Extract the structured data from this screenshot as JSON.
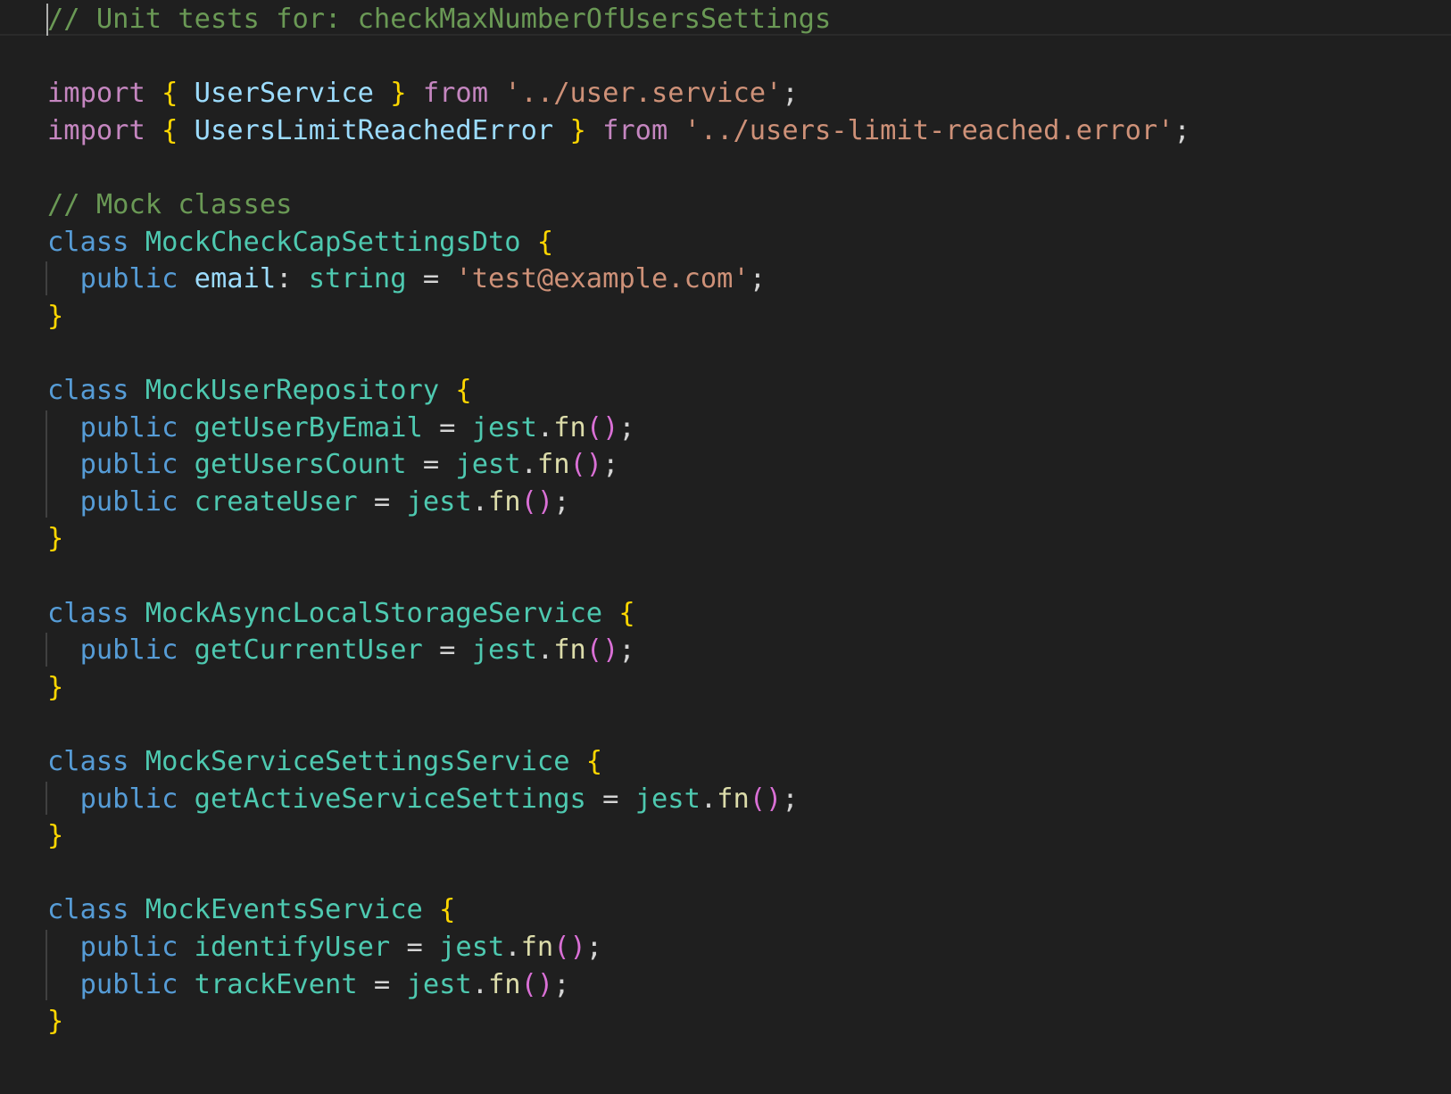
{
  "editor": {
    "language": "typescript",
    "theme_colors": {
      "background": "#1f1f1f",
      "comment": "#6a9955",
      "keyword": "#c586c0",
      "storage": "#569cd6",
      "brace": "#ffd700",
      "paren": "#da70d6",
      "variable": "#9cdcfe",
      "type": "#4ec9b0",
      "function": "#dcdcaa",
      "string": "#ce9178",
      "punctuation": "#d4d4d4"
    },
    "lines": [
      {
        "tokens": [
          {
            "text": "// Unit tests for: checkMaxNumberOfUsersSettings",
            "type": "comment"
          }
        ]
      },
      {
        "tokens": []
      },
      {
        "tokens": [
          {
            "text": "import",
            "type": "keyword"
          },
          {
            "text": " ",
            "type": "punct"
          },
          {
            "text": "{",
            "type": "brace"
          },
          {
            "text": " ",
            "type": "punct"
          },
          {
            "text": "UserService",
            "type": "var"
          },
          {
            "text": " ",
            "type": "punct"
          },
          {
            "text": "}",
            "type": "brace"
          },
          {
            "text": " ",
            "type": "punct"
          },
          {
            "text": "from",
            "type": "keyword"
          },
          {
            "text": " ",
            "type": "punct"
          },
          {
            "text": "'../user.service'",
            "type": "string"
          },
          {
            "text": ";",
            "type": "punct"
          }
        ]
      },
      {
        "tokens": [
          {
            "text": "import",
            "type": "keyword"
          },
          {
            "text": " ",
            "type": "punct"
          },
          {
            "text": "{",
            "type": "brace"
          },
          {
            "text": " ",
            "type": "punct"
          },
          {
            "text": "UsersLimitReachedError",
            "type": "var"
          },
          {
            "text": " ",
            "type": "punct"
          },
          {
            "text": "}",
            "type": "brace"
          },
          {
            "text": " ",
            "type": "punct"
          },
          {
            "text": "from",
            "type": "keyword"
          },
          {
            "text": " ",
            "type": "punct"
          },
          {
            "text": "'../users-limit-reached.error'",
            "type": "string"
          },
          {
            "text": ";",
            "type": "punct"
          }
        ]
      },
      {
        "tokens": []
      },
      {
        "tokens": [
          {
            "text": "// Mock classes",
            "type": "comment"
          }
        ]
      },
      {
        "tokens": [
          {
            "text": "class",
            "type": "storage"
          },
          {
            "text": " ",
            "type": "punct"
          },
          {
            "text": "MockCheckCapSettingsDto",
            "type": "type"
          },
          {
            "text": " ",
            "type": "punct"
          },
          {
            "text": "{",
            "type": "brace"
          }
        ]
      },
      {
        "tokens": [
          {
            "text": "  ",
            "type": "punct"
          },
          {
            "text": "public",
            "type": "storage"
          },
          {
            "text": " ",
            "type": "punct"
          },
          {
            "text": "email",
            "type": "var"
          },
          {
            "text": ": ",
            "type": "punct"
          },
          {
            "text": "string",
            "type": "type"
          },
          {
            "text": " = ",
            "type": "punct"
          },
          {
            "text": "'test@example.com'",
            "type": "string"
          },
          {
            "text": ";",
            "type": "punct"
          }
        ]
      },
      {
        "tokens": [
          {
            "text": "}",
            "type": "brace"
          }
        ]
      },
      {
        "tokens": []
      },
      {
        "tokens": [
          {
            "text": "class",
            "type": "storage"
          },
          {
            "text": " ",
            "type": "punct"
          },
          {
            "text": "MockUserRepository",
            "type": "type"
          },
          {
            "text": " ",
            "type": "punct"
          },
          {
            "text": "{",
            "type": "brace"
          }
        ]
      },
      {
        "tokens": [
          {
            "text": "  ",
            "type": "punct"
          },
          {
            "text": "public",
            "type": "storage"
          },
          {
            "text": " ",
            "type": "punct"
          },
          {
            "text": "getUserByEmail",
            "type": "type"
          },
          {
            "text": " = ",
            "type": "punct"
          },
          {
            "text": "jest",
            "type": "type"
          },
          {
            "text": ".",
            "type": "punct"
          },
          {
            "text": "fn",
            "type": "func"
          },
          {
            "text": "()",
            "type": "paren"
          },
          {
            "text": ";",
            "type": "punct"
          }
        ]
      },
      {
        "tokens": [
          {
            "text": "  ",
            "type": "punct"
          },
          {
            "text": "public",
            "type": "storage"
          },
          {
            "text": " ",
            "type": "punct"
          },
          {
            "text": "getUsersCount",
            "type": "type"
          },
          {
            "text": " = ",
            "type": "punct"
          },
          {
            "text": "jest",
            "type": "type"
          },
          {
            "text": ".",
            "type": "punct"
          },
          {
            "text": "fn",
            "type": "func"
          },
          {
            "text": "()",
            "type": "paren"
          },
          {
            "text": ";",
            "type": "punct"
          }
        ]
      },
      {
        "tokens": [
          {
            "text": "  ",
            "type": "punct"
          },
          {
            "text": "public",
            "type": "storage"
          },
          {
            "text": " ",
            "type": "punct"
          },
          {
            "text": "createUser",
            "type": "type"
          },
          {
            "text": " = ",
            "type": "punct"
          },
          {
            "text": "jest",
            "type": "type"
          },
          {
            "text": ".",
            "type": "punct"
          },
          {
            "text": "fn",
            "type": "func"
          },
          {
            "text": "()",
            "type": "paren"
          },
          {
            "text": ";",
            "type": "punct"
          }
        ]
      },
      {
        "tokens": [
          {
            "text": "}",
            "type": "brace"
          }
        ]
      },
      {
        "tokens": []
      },
      {
        "tokens": [
          {
            "text": "class",
            "type": "storage"
          },
          {
            "text": " ",
            "type": "punct"
          },
          {
            "text": "MockAsyncLocalStorageService",
            "type": "type"
          },
          {
            "text": " ",
            "type": "punct"
          },
          {
            "text": "{",
            "type": "brace"
          }
        ]
      },
      {
        "tokens": [
          {
            "text": "  ",
            "type": "punct"
          },
          {
            "text": "public",
            "type": "storage"
          },
          {
            "text": " ",
            "type": "punct"
          },
          {
            "text": "getCurrentUser",
            "type": "type"
          },
          {
            "text": " = ",
            "type": "punct"
          },
          {
            "text": "jest",
            "type": "type"
          },
          {
            "text": ".",
            "type": "punct"
          },
          {
            "text": "fn",
            "type": "func"
          },
          {
            "text": "()",
            "type": "paren"
          },
          {
            "text": ";",
            "type": "punct"
          }
        ]
      },
      {
        "tokens": [
          {
            "text": "}",
            "type": "brace"
          }
        ]
      },
      {
        "tokens": []
      },
      {
        "tokens": [
          {
            "text": "class",
            "type": "storage"
          },
          {
            "text": " ",
            "type": "punct"
          },
          {
            "text": "MockServiceSettingsService",
            "type": "type"
          },
          {
            "text": " ",
            "type": "punct"
          },
          {
            "text": "{",
            "type": "brace"
          }
        ]
      },
      {
        "tokens": [
          {
            "text": "  ",
            "type": "punct"
          },
          {
            "text": "public",
            "type": "storage"
          },
          {
            "text": " ",
            "type": "punct"
          },
          {
            "text": "getActiveServiceSettings",
            "type": "type"
          },
          {
            "text": " = ",
            "type": "punct"
          },
          {
            "text": "jest",
            "type": "type"
          },
          {
            "text": ".",
            "type": "punct"
          },
          {
            "text": "fn",
            "type": "func"
          },
          {
            "text": "()",
            "type": "paren"
          },
          {
            "text": ";",
            "type": "punct"
          }
        ]
      },
      {
        "tokens": [
          {
            "text": "}",
            "type": "brace"
          }
        ]
      },
      {
        "tokens": []
      },
      {
        "tokens": [
          {
            "text": "class",
            "type": "storage"
          },
          {
            "text": " ",
            "type": "punct"
          },
          {
            "text": "MockEventsService",
            "type": "type"
          },
          {
            "text": " ",
            "type": "punct"
          },
          {
            "text": "{",
            "type": "brace"
          }
        ]
      },
      {
        "tokens": [
          {
            "text": "  ",
            "type": "punct"
          },
          {
            "text": "public",
            "type": "storage"
          },
          {
            "text": " ",
            "type": "punct"
          },
          {
            "text": "identifyUser",
            "type": "type"
          },
          {
            "text": " = ",
            "type": "punct"
          },
          {
            "text": "jest",
            "type": "type"
          },
          {
            "text": ".",
            "type": "punct"
          },
          {
            "text": "fn",
            "type": "func"
          },
          {
            "text": "()",
            "type": "paren"
          },
          {
            "text": ";",
            "type": "punct"
          }
        ]
      },
      {
        "tokens": [
          {
            "text": "  ",
            "type": "punct"
          },
          {
            "text": "public",
            "type": "storage"
          },
          {
            "text": " ",
            "type": "punct"
          },
          {
            "text": "trackEvent",
            "type": "type"
          },
          {
            "text": " = ",
            "type": "punct"
          },
          {
            "text": "jest",
            "type": "type"
          },
          {
            "text": ".",
            "type": "punct"
          },
          {
            "text": "fn",
            "type": "func"
          },
          {
            "text": "()",
            "type": "paren"
          },
          {
            "text": ";",
            "type": "punct"
          }
        ]
      },
      {
        "tokens": [
          {
            "text": "}",
            "type": "brace"
          }
        ]
      }
    ]
  }
}
